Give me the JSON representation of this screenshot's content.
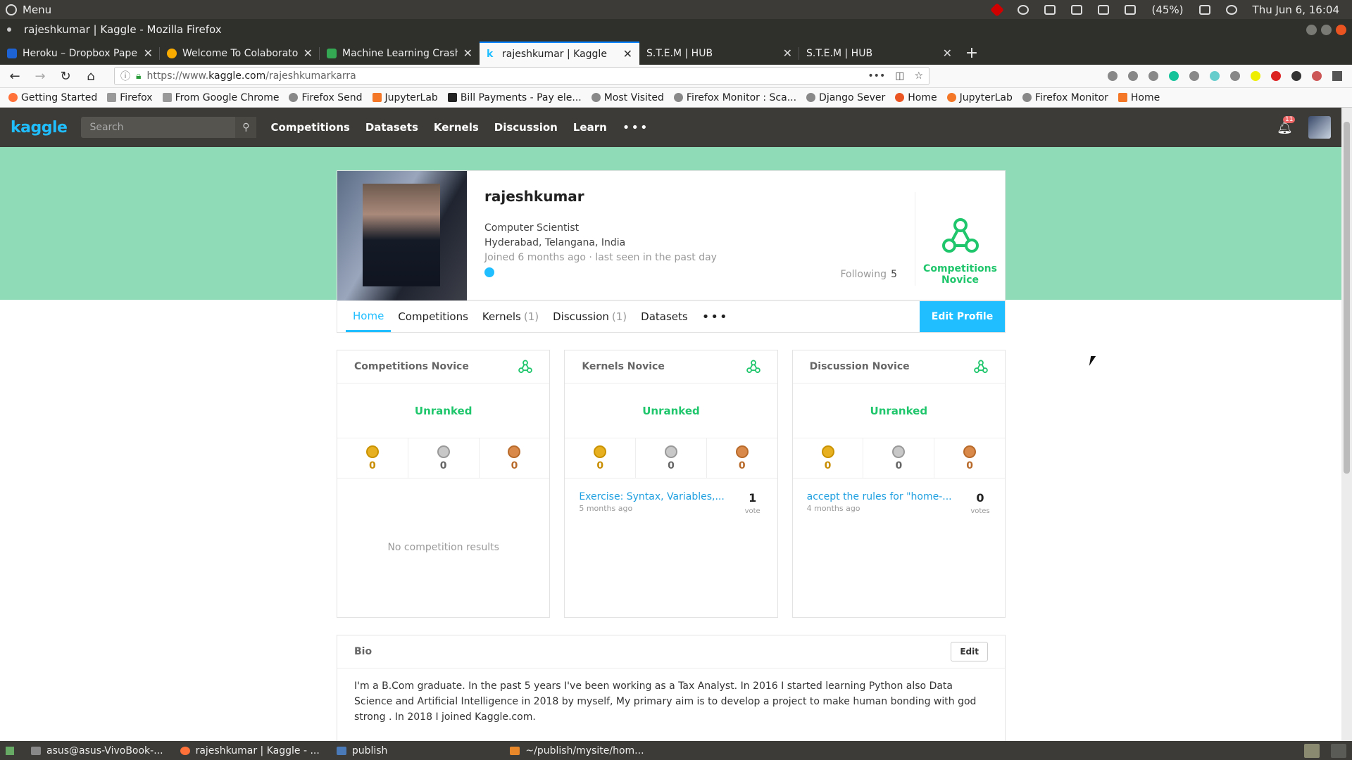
{
  "system": {
    "menu": "Menu",
    "battery": "(45%)",
    "clock": "Thu Jun 6, 16:04"
  },
  "window": {
    "title": "rajeshkumar | Kaggle - Mozilla Firefox"
  },
  "tabs": [
    {
      "label": "Heroku – Dropbox Paper",
      "color": "#1e63d6"
    },
    {
      "label": "Welcome To Colaboratory",
      "color": "#f9ab00"
    },
    {
      "label": "Machine Learning Crash C",
      "color": "#34a853"
    },
    {
      "label": "rajeshkumar | Kaggle",
      "color": "#20beff"
    },
    {
      "label": "S.T.E.M | HUB",
      "color": "#888888"
    },
    {
      "label": "S.T.E.M | HUB",
      "color": "#888888"
    }
  ],
  "url": {
    "proto": "https://www.",
    "host": "kaggle.com",
    "path": "/rajeshkumarkarra"
  },
  "bookmarks": [
    "Getting Started",
    "Firefox",
    "From Google Chrome",
    "Firefox Send",
    "JupyterLab",
    "Bill Payments - Pay ele...",
    "Most Visited",
    "Firefox Monitor : Sca...",
    "Django Sever",
    "Home",
    "JupyterLab",
    "Firefox Monitor",
    "Home"
  ],
  "kaggle": {
    "logo": "kaggle",
    "search_placeholder": "Search",
    "nav": [
      "Competitions",
      "Datasets",
      "Kernels",
      "Discussion",
      "Learn"
    ],
    "notif_count": "11"
  },
  "profile": {
    "name": "rajeshkumar",
    "occupation": "Computer Scientist",
    "location": "Hyderabad, Telangana, India",
    "joined": "Joined 6 months ago · last seen in the past day",
    "following_label": "Following",
    "following_count": "5",
    "tier": "Competitions Novice",
    "tabs": [
      {
        "label": "Home",
        "count": ""
      },
      {
        "label": "Competitions",
        "count": ""
      },
      {
        "label": "Kernels",
        "count": "(1)"
      },
      {
        "label": "Discussion",
        "count": "(1)"
      },
      {
        "label": "Datasets",
        "count": ""
      }
    ],
    "edit_label": "Edit Profile"
  },
  "columns": {
    "competitions": {
      "title": "Competitions Novice",
      "rank": "Unranked",
      "medals": [
        "0",
        "0",
        "0"
      ],
      "empty": "No competition results"
    },
    "kernels": {
      "title": "Kernels Novice",
      "rank": "Unranked",
      "medals": [
        "0",
        "0",
        "0"
      ],
      "item": {
        "title": "Exercise: Syntax, Variables,...",
        "ago": "5 months ago",
        "count": "1",
        "unit": "vote"
      }
    },
    "discussion": {
      "title": "Discussion Novice",
      "rank": "Unranked",
      "medals": [
        "0",
        "0",
        "0"
      ],
      "item": {
        "title": "accept the rules for \"home-...",
        "ago": "4 months ago",
        "count": "0",
        "unit": "votes"
      }
    }
  },
  "bio": {
    "title": "Bio",
    "edit": "Edit",
    "text": "I'm a B.Com graduate. In the past 5 years I've been working as a Tax Analyst. In 2016 I started learning Python also Data Science and Artificial Intelligence in 2018 by myself, My primary aim is to develop a project to make human bonding with god strong . In 2018 I joined Kaggle.com."
  },
  "taskbar": [
    "asus@asus-VivoBook-...",
    "rajeshkumar | Kaggle - ...",
    "publish",
    "~/publish/mysite/hom..."
  ]
}
